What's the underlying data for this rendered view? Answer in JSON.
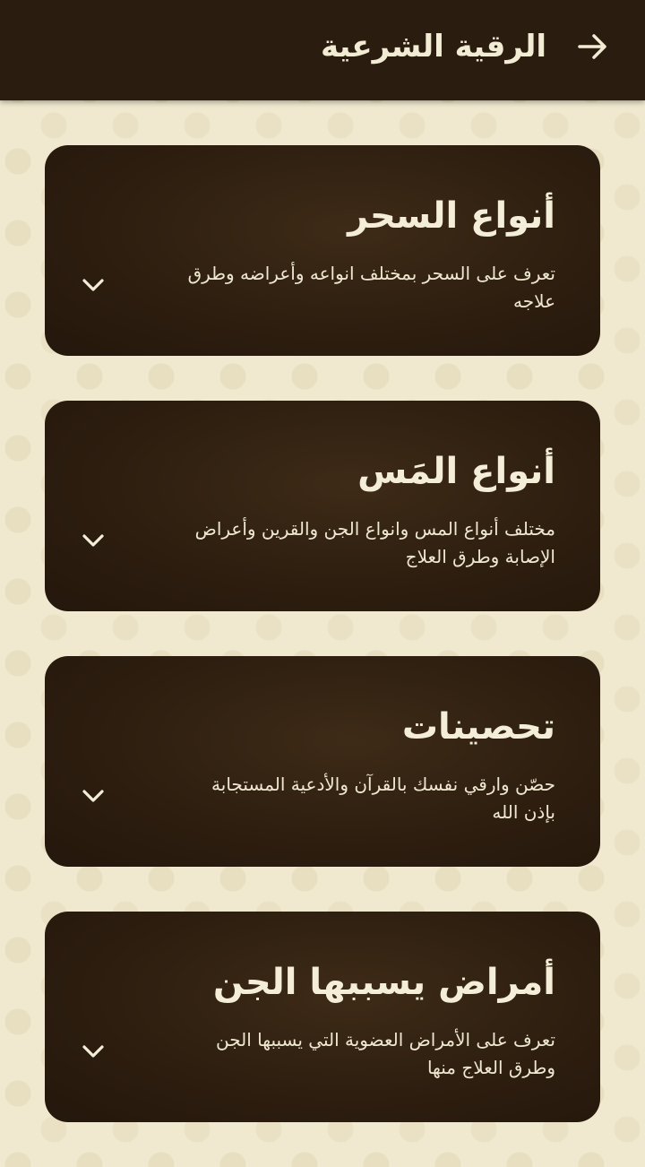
{
  "header": {
    "title": "الرقية الشرعية",
    "back_icon": "arrow-right-icon"
  },
  "colors": {
    "header_bg": "#2a1c0f",
    "card_bg": "#2c1d0f",
    "page_bg": "#f0e9cf",
    "text": "#f4eed8"
  },
  "cards": [
    {
      "title": "أنواع السحر",
      "description": "تعرف على السحر بمختلف انواعه وأعراضه وطرق علاجه",
      "icon": "chevron-down-icon"
    },
    {
      "title": "أنواع المَس",
      "description": "مختلف أنواع المس وانواع الجن والقرين وأعراض الإصابة وطرق العلاج",
      "icon": "chevron-down-icon"
    },
    {
      "title": "تحصينات",
      "description": "حصّن وارقي نفسك بالقرآن والأدعية المستجابة بإذن الله",
      "icon": "chevron-down-icon"
    },
    {
      "title": "أمراض يسببها الجن",
      "description": "تعرف على الأمراض العضوية التي يسببها الجن وطرق العلاج منها",
      "icon": "chevron-down-icon"
    }
  ]
}
